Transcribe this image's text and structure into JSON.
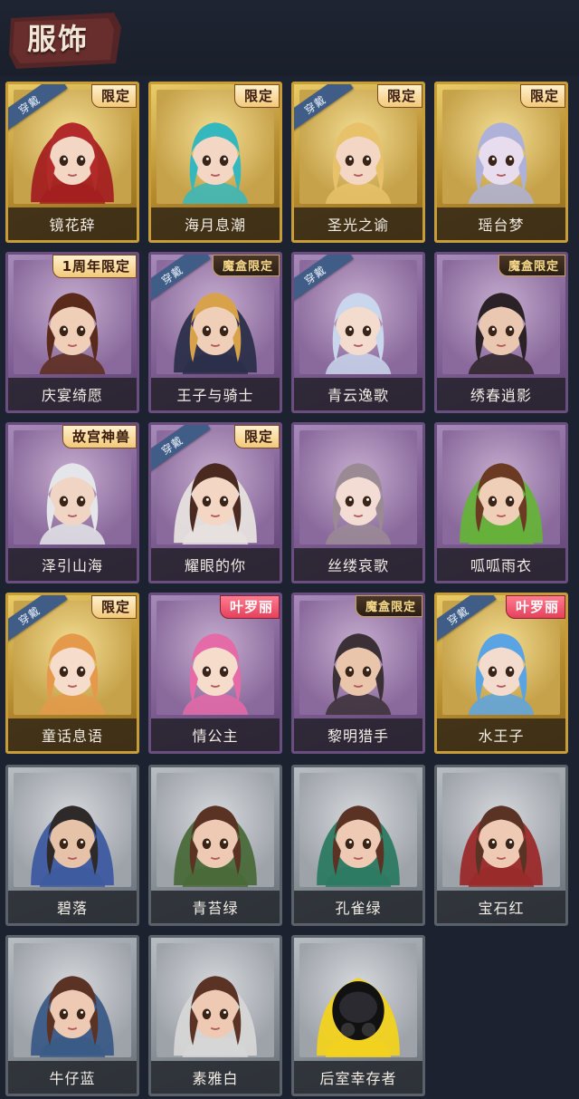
{
  "header": {
    "title": "服饰"
  },
  "colors": {
    "gold_frame": "#c79d3a",
    "purple_frame": "#6a4e80",
    "gray_frame": "#5b6169",
    "worn_tag": "#3f5d86"
  },
  "costumes": [
    {
      "name": "镜花辞",
      "tier": "gold",
      "worn": "穿戴",
      "badge": "限定",
      "badge_style": "limited",
      "hair": "#b32a2a",
      "hood": "#a32020",
      "skin": "#f3d6c4"
    },
    {
      "name": "海月息潮",
      "tier": "gold",
      "worn": "",
      "badge": "限定",
      "badge_style": "limited",
      "hair": "#34b8bd",
      "hood": "",
      "skin": "#f3d6c4"
    },
    {
      "name": "圣光之谕",
      "tier": "gold",
      "worn": "穿戴",
      "badge": "限定",
      "badge_style": "limited",
      "hair": "#e7c26a",
      "hood": "",
      "skin": "#f3d6c4"
    },
    {
      "name": "瑶台梦",
      "tier": "gold",
      "worn": "",
      "badge": "限定",
      "badge_style": "limited",
      "hair": "#aeb1d8",
      "hood": "",
      "skin": "#e8dcef"
    },
    {
      "name": "庆宴绮愿",
      "tier": "purple",
      "worn": "",
      "badge": "1周年限定",
      "badge_style": "limited",
      "hair": "#5a2a1a",
      "hood": "",
      "skin": "#f0cfb8"
    },
    {
      "name": "王子与骑士",
      "tier": "purple",
      "worn": "穿戴",
      "badge": "魔盒限定",
      "badge_style": "dark",
      "hair": "#d8a24a",
      "hood": "#2c2f4a",
      "skin": "#f0cfb8"
    },
    {
      "name": "青云逸歌",
      "tier": "purple",
      "worn": "穿戴",
      "badge": "",
      "badge_style": "",
      "hair": "#c9d6ec",
      "hood": "",
      "skin": "#f3dccd"
    },
    {
      "name": "绣春逍影",
      "tier": "purple",
      "worn": "",
      "badge": "魔盒限定",
      "badge_style": "dark",
      "hair": "#2a2226",
      "hood": "",
      "skin": "#eac7b1"
    },
    {
      "name": "泽引山海",
      "tier": "purple",
      "worn": "",
      "badge": "故宫神兽",
      "badge_style": "limited",
      "hair": "#e4e6ea",
      "hood": "",
      "skin": "#f0d5c4"
    },
    {
      "name": "耀眼的你",
      "tier": "purple",
      "worn": "穿戴",
      "badge": "限定",
      "badge_style": "limited",
      "hair": "#4a2a20",
      "hood": "#e6e2de",
      "skin": "#f3d6c4"
    },
    {
      "name": "丝缕哀歌",
      "tier": "purple",
      "worn": "",
      "badge": "",
      "badge_style": "",
      "hair": "#9a8a94",
      "hood": "",
      "skin": "#f2dcd4"
    },
    {
      "name": "呱呱雨衣",
      "tier": "purple",
      "worn": "",
      "badge": "",
      "badge_style": "",
      "hair": "#6a3a22",
      "hood": "#66b23a",
      "skin": "#f0cfb8"
    },
    {
      "name": "童话息语",
      "tier": "gold",
      "worn": "穿戴",
      "badge": "限定",
      "badge_style": "limited",
      "hair": "#e49a4a",
      "hood": "",
      "skin": "#f6dccb"
    },
    {
      "name": "情公主",
      "tier": "purple",
      "worn": "",
      "badge": "叶罗丽",
      "badge_style": "red",
      "hair": "#e46aa8",
      "hood": "",
      "skin": "#f6dccb"
    },
    {
      "name": "黎明猎手",
      "tier": "purple",
      "worn": "",
      "badge": "魔盒限定",
      "badge_style": "dark",
      "hair": "#3a3036",
      "hood": "",
      "skin": "#e9c5ab"
    },
    {
      "name": "水王子",
      "tier": "gold",
      "worn": "穿戴",
      "badge": "叶罗丽",
      "badge_style": "red",
      "hair": "#5aa4e4",
      "hood": "",
      "skin": "#f3dccd"
    },
    {
      "name": "碧落",
      "tier": "gray",
      "worn": "",
      "badge": "",
      "badge_style": "",
      "hair": "#2e2a2a",
      "hood": "#3d5aa0",
      "skin": "#e6c3a8"
    },
    {
      "name": "青苔绿",
      "tier": "gray",
      "worn": "",
      "badge": "",
      "badge_style": "",
      "hair": "#5a3324",
      "hood": "#4a6a3a",
      "skin": "#eecab4"
    },
    {
      "name": "孔雀绿",
      "tier": "gray",
      "worn": "",
      "badge": "",
      "badge_style": "",
      "hair": "#5a3324",
      "hood": "#2c7a62",
      "skin": "#eecab4"
    },
    {
      "name": "宝石红",
      "tier": "gray",
      "worn": "",
      "badge": "",
      "badge_style": "",
      "hair": "#5a3324",
      "hood": "#9a2a2a",
      "skin": "#eecab4"
    },
    {
      "name": "牛仔蓝",
      "tier": "gray",
      "worn": "",
      "badge": "",
      "badge_style": "",
      "hair": "#5a3324",
      "hood": "#3a5a86",
      "skin": "#eecab4"
    },
    {
      "name": "素雅白",
      "tier": "gray",
      "worn": "",
      "badge": "",
      "badge_style": "",
      "hair": "#5a3324",
      "hood": "#d6d6d6",
      "skin": "#eecab4"
    },
    {
      "name": "后室幸存者",
      "tier": "gray",
      "worn": "",
      "badge": "",
      "badge_style": "",
      "hair": "#151515",
      "hood": "#f2d21e",
      "skin": "#222222"
    }
  ]
}
